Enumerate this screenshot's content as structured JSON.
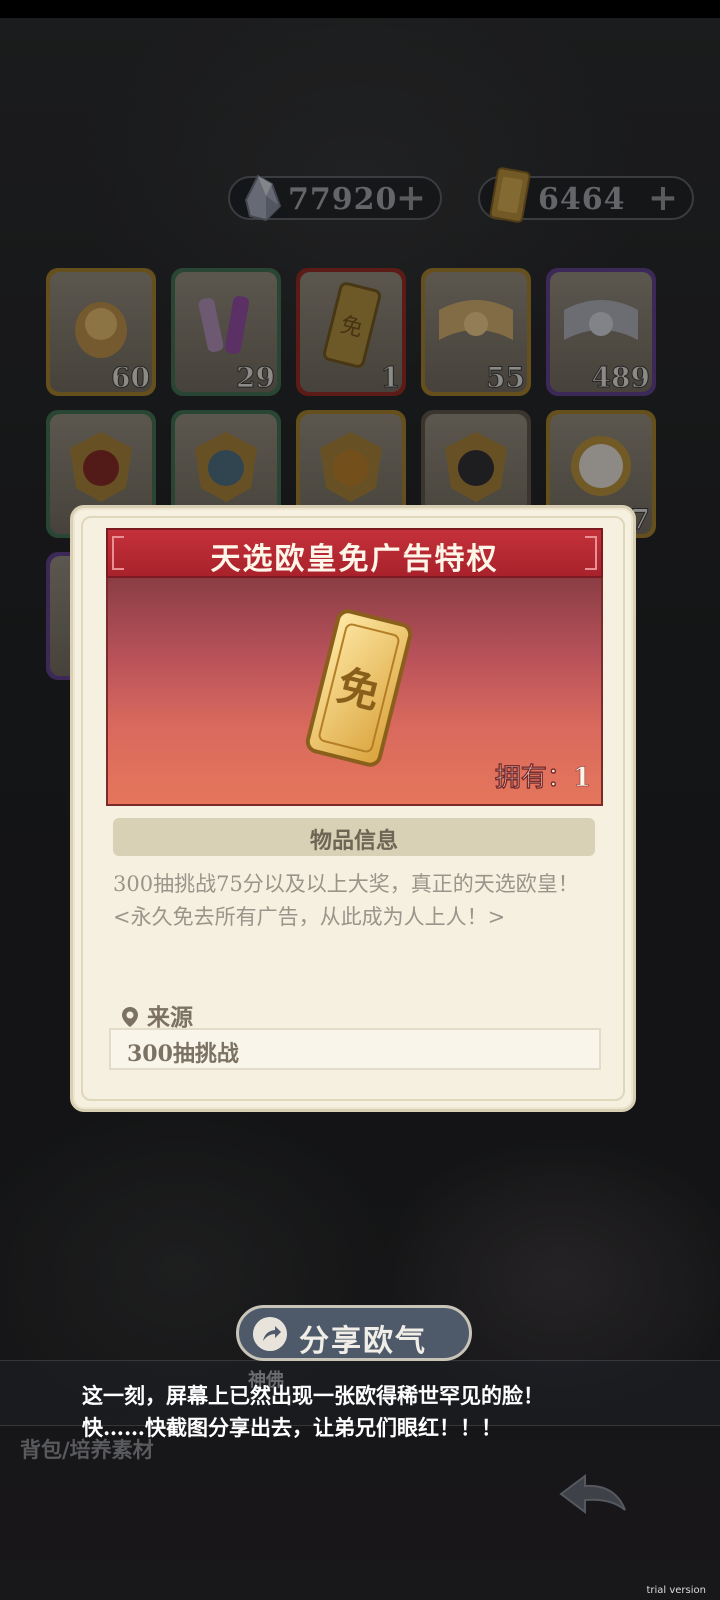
{
  "currency": {
    "crystals": "77920",
    "tickets": "6464",
    "plus_symbol": "+"
  },
  "inventory": {
    "row1_counts": [
      "60",
      "29",
      "1",
      "55",
      "489"
    ],
    "row2_partial_count": "7"
  },
  "item_popup": {
    "title": "天选欧皇免广告特权",
    "owned_label": "拥有：1",
    "info_header": "物品信息",
    "description_line1": "300抽挑战75分以及以上大奖，真正的天选欧皇！",
    "description_line2": "<永久免去所有广告，从此成为人上人！>",
    "source_label": "来源",
    "source_value": "300抽挑战",
    "ticket_glyph": "免"
  },
  "share_button": {
    "label": "分享欧气"
  },
  "caption": {
    "line1": "这一刻，屏幕上已然出现一张欧得稀世罕见的脸！",
    "line2": "快……快截图分享出去，让弟兄们眼红！！！"
  },
  "bottom": {
    "ghost_label": "神佛",
    "tab_label": "背包/培养素材"
  },
  "watermark": "trial version",
  "colors": {
    "modal_bg": "#f6f0e1",
    "title_red": "#c5313a",
    "share_button": "#4e5a6a"
  }
}
